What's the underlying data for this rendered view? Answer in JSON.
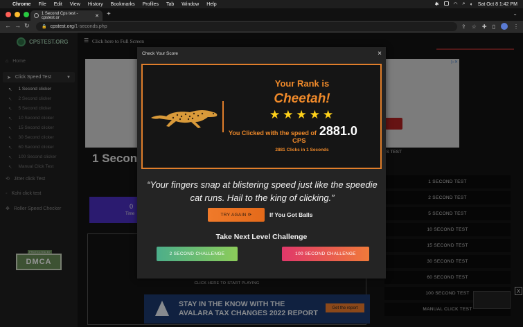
{
  "menubar": {
    "apple": "",
    "items": [
      "Chrome",
      "File",
      "Edit",
      "View",
      "History",
      "Bookmarks",
      "Profiles",
      "Tab",
      "Window",
      "Help"
    ],
    "datetime": "Sat Oct 8  1:42 PM"
  },
  "browser": {
    "tab_title": "1 Second Cps test - cpstest.or",
    "url_domain": "cpstest.org",
    "url_path": "/1-seconds.php"
  },
  "sidebar": {
    "logo": "CPSTEST.ORG",
    "home": "Home",
    "click_speed_test": "Click Speed Test",
    "sub_items": [
      "1 Second clicker",
      "2 Second clicker",
      "5 Second clicker",
      "10 Second clicker",
      "15 Second clicker",
      "30 Second clicker",
      "60 Second clicker",
      "100 Second clicker",
      "Manual Click Test"
    ],
    "jitter": "Jitter click Test",
    "kohi": "Kohi click test",
    "roller": "Roller Speed Checker",
    "dmca_top": "PROTECTED BY",
    "dmca": "DMCA"
  },
  "main": {
    "fullscreen": "Click here to Full Screen",
    "bg_title": "1 Second",
    "counter_value": "0",
    "counter_label": "Time",
    "click_area_label": "CLICK HERE TO START PLAYING",
    "right_list_head": "PS TEST",
    "right_list": [
      "1 SECOND TEST",
      "2 SECOND TEST",
      "5 SECOND TEST",
      "10 SECOND TEST",
      "15 SECOND TEST",
      "30 SECOND TEST",
      "60 SECOND TEST",
      "100 SECOND TEST",
      "MANUAL CLICK TEST"
    ],
    "ad_line1": "STAY IN THE KNOW WITH THE",
    "ad_line2": "AVALARA TAX CHANGES 2022 REPORT",
    "ad_cta": "Get the report",
    "ad_close": "X"
  },
  "modal": {
    "title": "Check Your Score",
    "close": "×",
    "rank_label": "Your Rank is",
    "rank_value": "Cheetah!",
    "stars": 5,
    "speed_text": "You Clicked with the speed of",
    "speed_value": "2881.0",
    "unit": "CPS",
    "clicks_in": "2881 Clicks in 1 Seconds",
    "quote_line1": "“Your fingers snap at blistering speed just like the speedie",
    "quote_line2": "cat runs. Hail to the king of clicking.”",
    "try_again": "TRY AGAIN ⟳",
    "balls_text": "If You Got Balls",
    "next_title": "Take Next Level Challenge",
    "challenge_left": "2 SECOND CHALLENGE",
    "challenge_right": "100 SECOND CHALLENGE"
  }
}
